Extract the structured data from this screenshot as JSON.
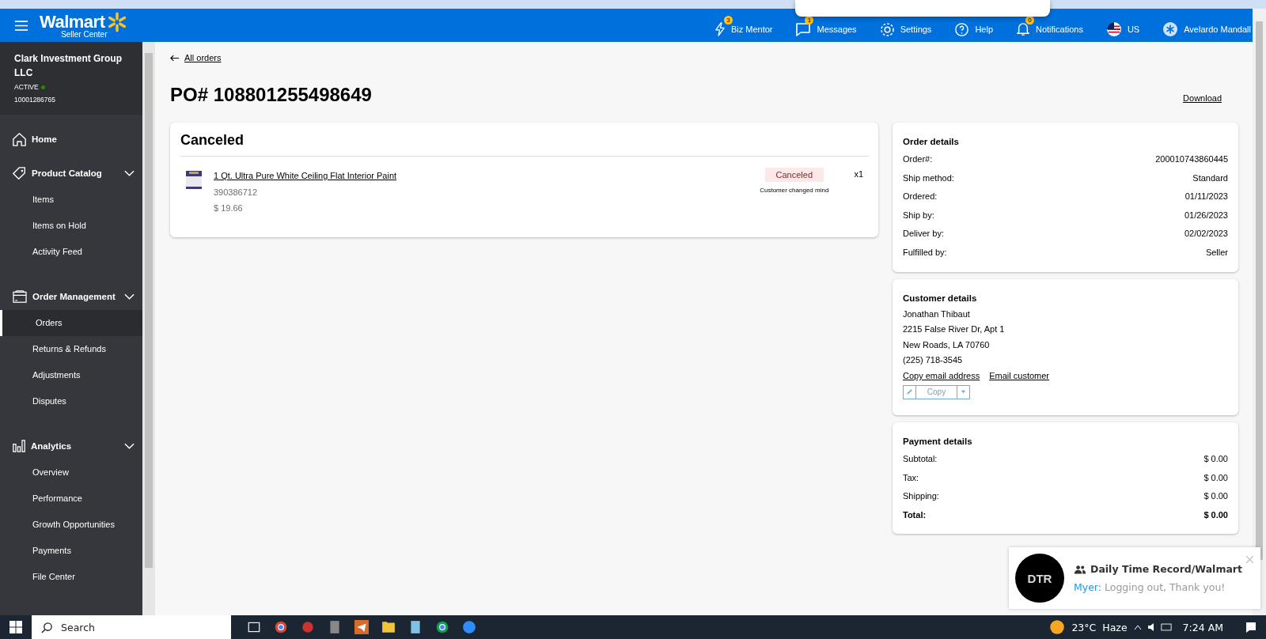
{
  "header": {
    "logo": "Walmart",
    "logo_sub": "Seller Center",
    "nav": [
      {
        "label": "Biz Mentor",
        "badge": "3"
      },
      {
        "label": "Messages",
        "badge": "1"
      },
      {
        "label": "Settings"
      },
      {
        "label": "Help"
      },
      {
        "label": "Notifications",
        "badge": "0"
      },
      {
        "label": "US"
      },
      {
        "label": "Avelardo Mandall"
      }
    ]
  },
  "sidebar": {
    "org": "Clark Investment Group LLC",
    "status": "ACTIVE",
    "account": "10001286765",
    "items": [
      {
        "label": "Home"
      },
      {
        "label": "Product Catalog",
        "expanded": true,
        "children": [
          {
            "label": "Items",
            "selected": false
          },
          {
            "label": "Items on Hold",
            "selected": false
          },
          {
            "label": "Activity Feed",
            "selected": false
          }
        ]
      },
      {
        "label": "Order Management",
        "expanded": true,
        "children": [
          {
            "label": "Orders",
            "selected": true
          },
          {
            "label": "Returns & Refunds",
            "selected": false
          },
          {
            "label": "Adjustments",
            "selected": false
          },
          {
            "label": "Disputes",
            "selected": false
          }
        ]
      },
      {
        "label": "Analytics",
        "expanded": true,
        "children": [
          {
            "label": "Overview",
            "selected": false
          },
          {
            "label": "Performance",
            "selected": false
          },
          {
            "label": "Growth Opportunities",
            "selected": false
          },
          {
            "label": "Payments",
            "selected": false
          },
          {
            "label": "File Center",
            "selected": false
          }
        ]
      }
    ]
  },
  "main": {
    "back_link": "All orders",
    "title": "PO# 108801255498649",
    "download": "Download",
    "status_card": {
      "title": "Canceled",
      "items": [
        {
          "name": "1 Qt. Ultra Pure White Ceiling Flat Interior Paint",
          "sku": "390386712",
          "price": "$ 19.66",
          "status": "Canceled",
          "reason": "Customer changed mind",
          "qty": "x1"
        }
      ]
    },
    "order_details": {
      "title": "Order details",
      "rows": [
        {
          "label": "Order#:",
          "value": "200010743860445"
        },
        {
          "label": "Ship method:",
          "value": "Standard"
        },
        {
          "label": "Ordered:",
          "value": "01/11/2023"
        },
        {
          "label": "Ship by:",
          "value": "01/26/2023"
        },
        {
          "label": "Deliver by:",
          "value": "02/02/2023"
        },
        {
          "label": "Fulfilled by:",
          "value": "Seller"
        }
      ]
    },
    "customer_details": {
      "title": "Customer details",
      "lines": [
        "Jonathan Thibaut",
        "2215 False River Dr, Apt 1",
        "New Roads, LA 70760",
        "(225) 718-3545"
      ],
      "links": [
        "Copy email address",
        "Email customer"
      ],
      "copy_button": "Copy"
    },
    "payment_details": {
      "title": "Payment details",
      "rows": [
        {
          "label": "Subtotal:",
          "value": "$ 0.00",
          "kind": "line"
        },
        {
          "label": "Tax:",
          "value": "$ 0.00",
          "kind": "line"
        },
        {
          "label": "Shipping:",
          "value": "$ 0.00",
          "kind": "line"
        },
        {
          "label": "Total:",
          "value": "$ 0.00",
          "kind": "total"
        }
      ]
    }
  },
  "chat_notification": {
    "avatar": "DTR",
    "title": "Daily Time Record/Walmart",
    "sender": "Myer:",
    "message": "Logging out, Thank you!"
  },
  "taskbar": {
    "search": "Search",
    "temperature": "23°C",
    "weather": "Haze",
    "time": "7:24 AM"
  }
}
